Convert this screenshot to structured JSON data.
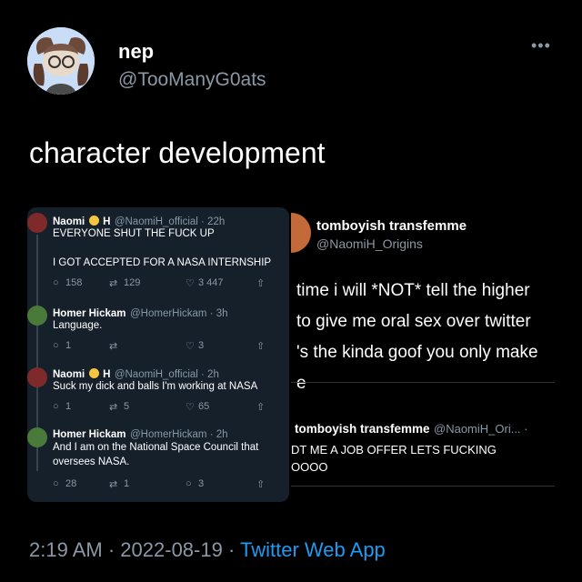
{
  "author": {
    "display_name": "nep",
    "handle": "@TooManyG0ats"
  },
  "tweet": {
    "text": "character development"
  },
  "embed_left": {
    "tweets": [
      {
        "name": "Naomi",
        "name_suffix": "H",
        "meta": "@NaomiH_official · 22h",
        "lines": [
          "EVERYONE SHUT THE FUCK UP",
          "",
          "I GOT ACCEPTED FOR A NASA INTERNSHIP"
        ],
        "replies": "158",
        "retweets": "129",
        "likes": "3 447"
      },
      {
        "name": "Homer Hickam",
        "meta": "@HomerHickam · 3h",
        "lines": [
          "Language."
        ],
        "replies": "1",
        "retweets": "",
        "likes": "3"
      },
      {
        "name": "Naomi",
        "name_suffix": "H",
        "meta": "@NaomiH_official · 2h",
        "lines": [
          "Suck my dick and balls I'm working at NASA"
        ],
        "replies": "1",
        "retweets": "5",
        "likes": "65"
      },
      {
        "name": "Homer Hickam",
        "meta": "@HomerHickam · 2h",
        "lines": [
          "And I am on the National Space Council that",
          "oversees NASA."
        ],
        "replies": "28",
        "retweets": "1",
        "likes": "3"
      }
    ]
  },
  "embed_right": {
    "name": "tomboyish transfemme",
    "handle": "@NaomiH_Origins",
    "body_lines": [
      "time i will *NOT* tell the higher",
      "to give me oral sex over twitter",
      "'s the kinda goof you only make",
      "e"
    ],
    "quoted": {
      "name": "tomboyish transfemme",
      "handle": "@NaomiH_Ori... ·",
      "lines": [
        "DT ME A JOB OFFER LETS FUCKING",
        "OOOO"
      ]
    }
  },
  "footer": {
    "time": "2:19 AM",
    "sep1": "·",
    "date": "2022-08-19",
    "sep2": "·",
    "app": "Twitter Web App"
  },
  "icons": [
    "more-icon",
    "reply-icon",
    "retweet-icon",
    "like-icon",
    "share-icon",
    "sunglasses-emoji-icon"
  ],
  "colors": {
    "background": "#000000",
    "embed_left_bg": "#15202b",
    "secondary_text": "#8b98a5",
    "link": "#1d9bf0"
  }
}
